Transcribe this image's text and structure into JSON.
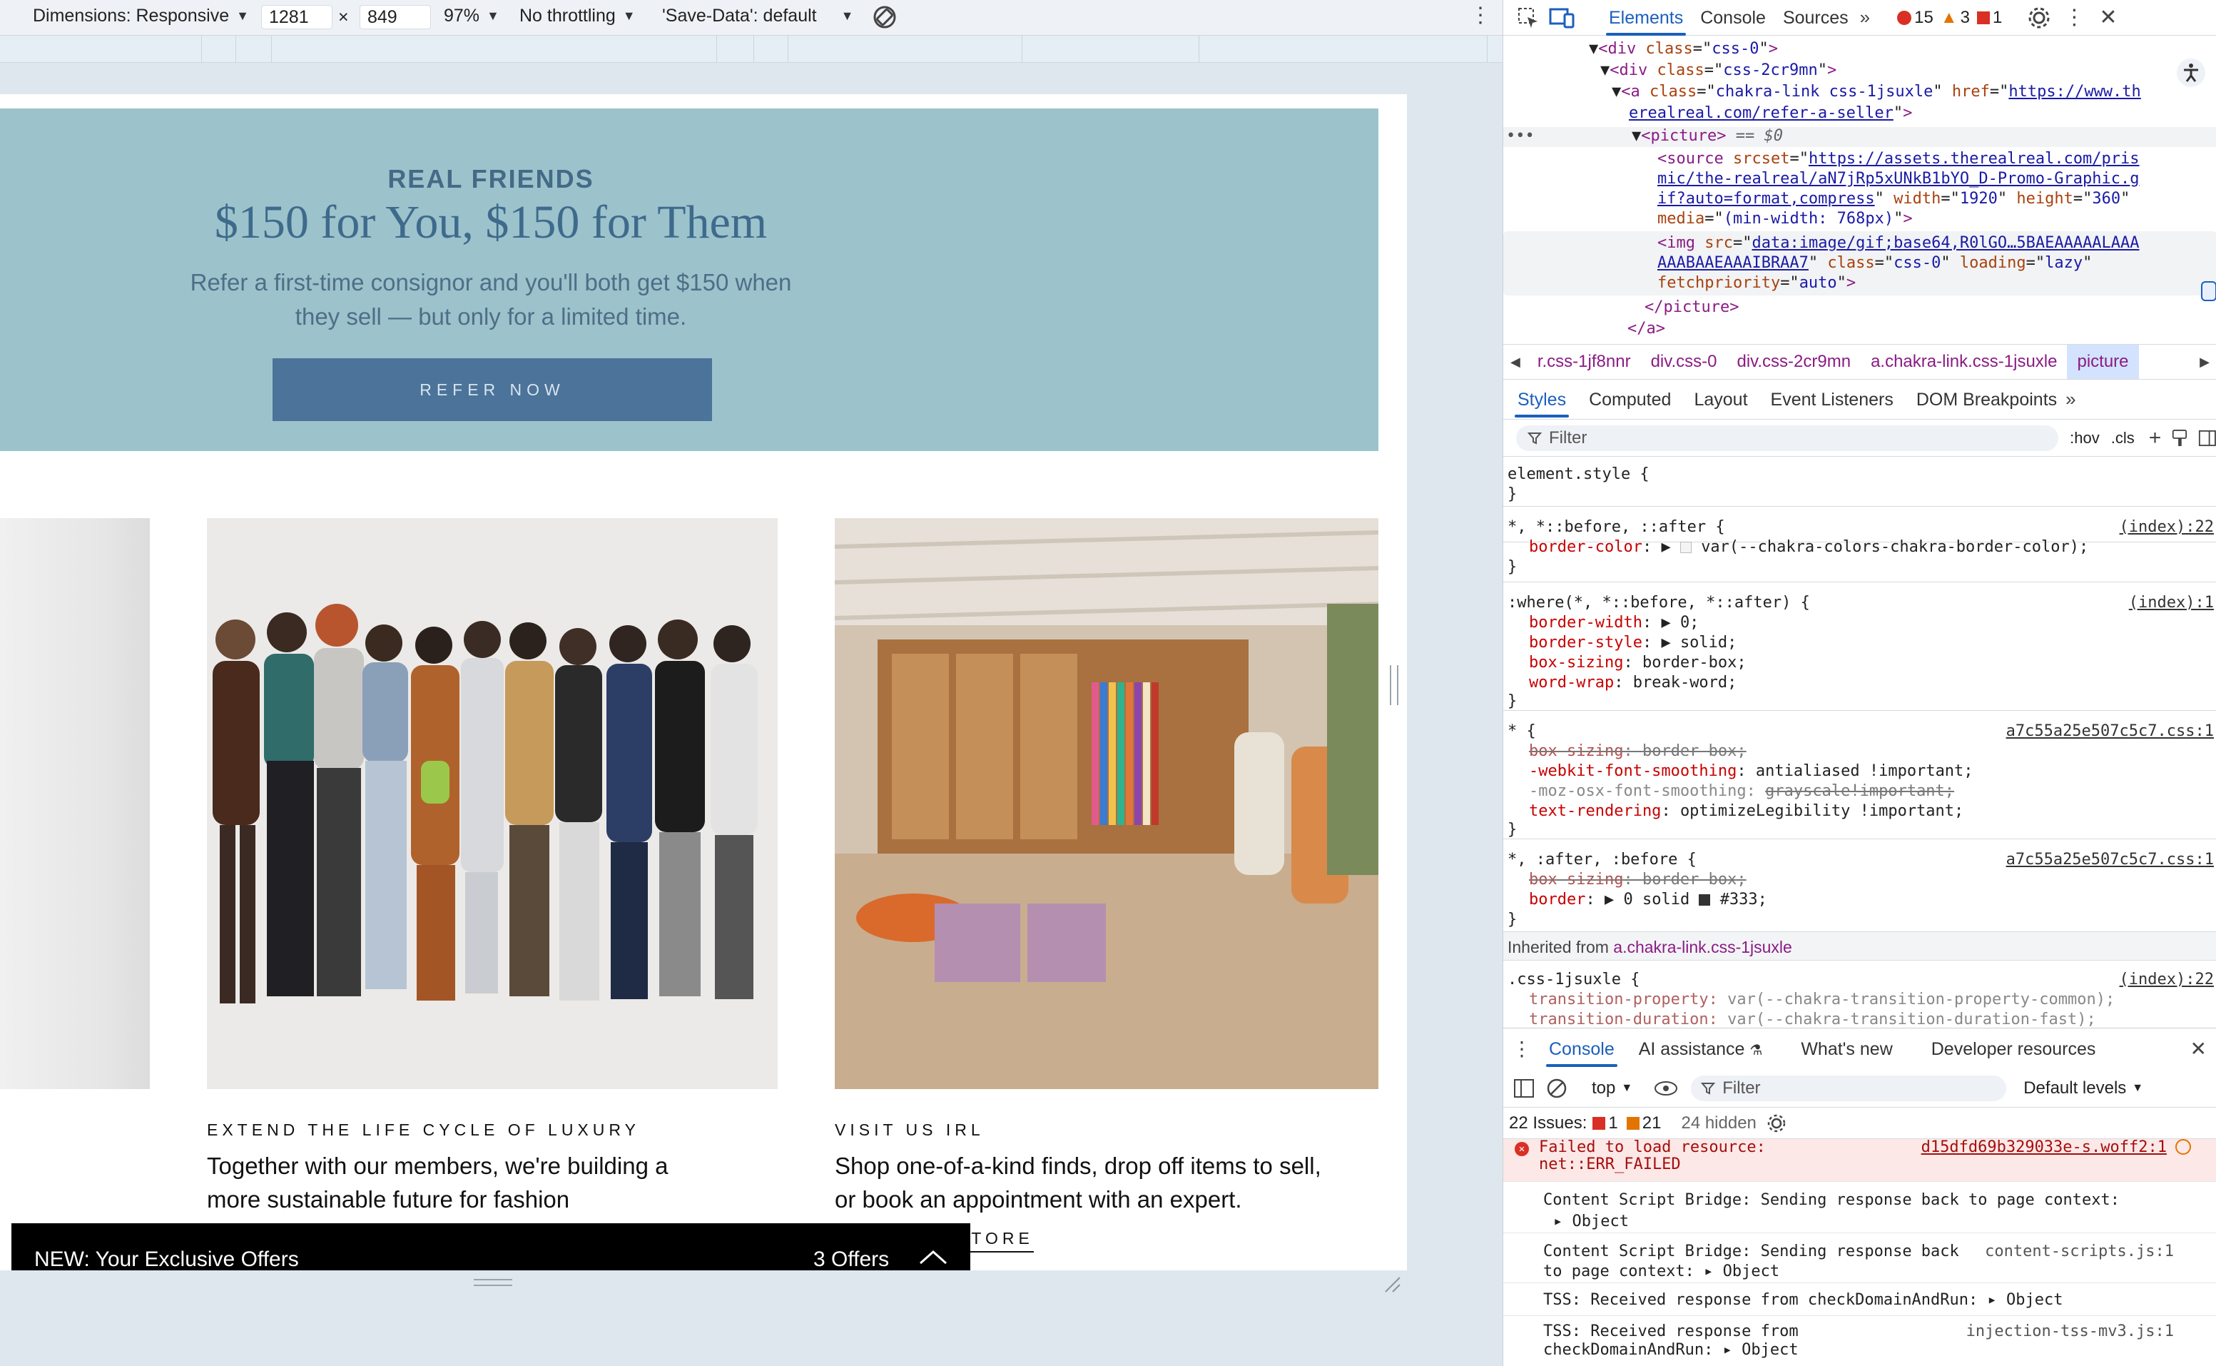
{
  "device_toolbar": {
    "dimensions_label": "Dimensions: Responsive",
    "width": "1281",
    "times": "×",
    "height": "849",
    "zoom": "97%",
    "throttling": "No throttling",
    "save_data": "'Save-Data': default"
  },
  "page": {
    "promo": {
      "kicker": "REAL FRIENDS",
      "title": "$150 for You, $150 for Them",
      "body": "Refer a first-time consignor and you'll both get $150 when they sell — but only for a limited time.",
      "button": "REFER NOW"
    },
    "cards": [
      {
        "kicker": "EXTEND THE LIFE CYCLE OF LUXURY",
        "body": "Together with our members, we're building a more sustainable future for fashion"
      },
      {
        "kicker": "VISIT US IRL",
        "body": "Shop one-of-a-kind finds, drop off items to sell, or book an appointment with an expert.",
        "link": "STORE"
      }
    ],
    "offers_bar": {
      "title": "NEW: Your Exclusive Offers",
      "count": "3 Offers"
    }
  },
  "devtools": {
    "tabs": [
      "Elements",
      "Console",
      "Sources"
    ],
    "active_tab": "Elements",
    "errors": "15",
    "warnings": "3",
    "info": "1",
    "dom": {
      "l1_tag": "div",
      "l1_class": "css-0",
      "l2_tag": "div",
      "l2_class": "css-2cr9mn",
      "l3_class": "chakra-link css-1jsuxle",
      "l3_href_a": "https://www.th",
      "l3_href_b": "erealreal.com/refer-a-seller",
      "picture_marker": "== $0",
      "source_srcset_a": "https://assets.therealreal.com/pris",
      "source_srcset_b": "mic/the-realreal/aN7jRp5xUNkB1bYO_D-Promo-Graphic.g",
      "source_srcset_c": "if?auto=format,compress",
      "source_width": "1920",
      "source_height": "360",
      "source_media": "(min-width: 768px)",
      "img_src_a": "data:image/gif;base64,R0lGO…5BAEAAAAALAAA",
      "img_src_b": "AAABAAEAAAIBRAA7",
      "img_class": "css-0",
      "img_loading": "lazy",
      "img_fetchpriority": "auto"
    },
    "breadcrumbs": [
      "r.css-1jf8nnr",
      "div.css-0",
      "div.css-2cr9mn",
      "a.chakra-link.css-1jsuxle",
      "picture"
    ],
    "styles_tabs": [
      "Styles",
      "Computed",
      "Layout",
      "Event Listeners",
      "DOM Breakpoints"
    ],
    "styles_filter": "Filter",
    "hov": ":hov",
    "cls": ".cls",
    "styles": {
      "element_style": "element.style {",
      "r1_sel": "*, *::before, ::after {",
      "r1_src": "(index):22",
      "r1_p1": "border-color",
      "r1_v1": "var(--chakra-colors-chakra-border-color);",
      "r2_sel": ":where(*, *::before, *::after) {",
      "r2_src": "(index):1",
      "r2_p1": "border-width",
      "r2_v1": "0;",
      "r2_p2": "border-style",
      "r2_v2": "solid;",
      "r2_p3": "box-sizing",
      "r2_v3": "border-box;",
      "r2_p4": "word-wrap",
      "r2_v4": "break-word;",
      "r3_sel": "* {",
      "r3_src": "a7c55a25e507c5c7.css:1",
      "r3_p1": "box-sizing",
      "r3_v1": "border-box;",
      "r3_p2": "-webkit-font-smoothing",
      "r3_v2": "antialiased !important;",
      "r3_p3": "-moz-osx-font-smoothing",
      "r3_v3": "grayscale!important;",
      "r3_p4": "text-rendering",
      "r3_v4": "optimizeLegibility !important;",
      "r4_sel": "*, :after, :before {",
      "r4_src": "a7c55a25e507c5c7.css:1",
      "r4_p1": "box-sizing",
      "r4_v1": "border-box;",
      "r4_p2": "border",
      "r4_v2": "0 solid",
      "r4_v2b": "#333;",
      "inherited_label": "Inherited from",
      "inherited_from": "a.chakra-link.css-1jsuxle",
      "r5_sel": ".css-1jsuxle {",
      "r5_src": "(index):22",
      "r5_p1": "transition-property",
      "r5_v1": "var(--chakra-transition-property-common);",
      "r5_p2": "transition-duration",
      "r5_v2": "var(--chakra-transition-duration-fast);"
    },
    "console": {
      "tabs": [
        "Console",
        "AI assistance",
        "What's new",
        "Developer resources"
      ],
      "context": "top",
      "filter": "Filter",
      "levels": "Default levels",
      "issues_label": "22 Issues:",
      "issues_errors": "1",
      "issues_warnings": "21",
      "hidden": "24 hidden",
      "messages": [
        {
          "text": "Failed to load resource:",
          "text2": "net::ERR_FAILED",
          "src": "d15dfd69b329033e-s.woff2:1"
        },
        {
          "text": "Content Script Bridge: Sending response back to page context:",
          "text2": "Object",
          "src": ""
        },
        {
          "text": "Content Script Bridge: Sending response back",
          "text2": "to page context:",
          "obj": "Object",
          "src": "content-scripts.js:1"
        },
        {
          "text": "TSS: Received response from checkDomainAndRun:",
          "obj": "Object",
          "src": ""
        },
        {
          "text": "TSS: Received response from",
          "text2": "checkDomainAndRun:",
          "obj": "Object",
          "src": "injection-tss-mv3.js:1"
        }
      ]
    }
  }
}
